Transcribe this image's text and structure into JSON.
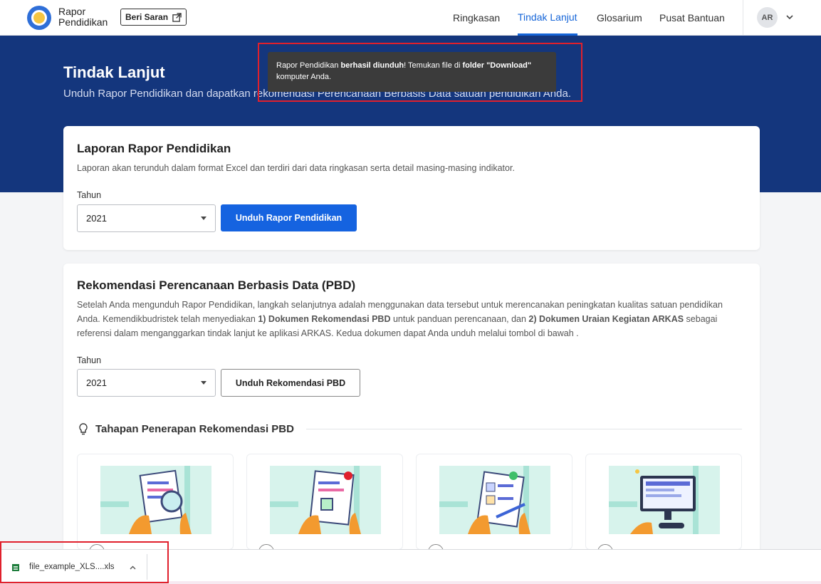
{
  "header": {
    "brand_line1": "Rapor",
    "brand_line2": "Pendidikan",
    "feedback_label": "Beri Saran",
    "nav": [
      {
        "label": "Ringkasan"
      },
      {
        "label": "Tindak Lanjut"
      },
      {
        "label": "Glosarium"
      },
      {
        "label": "Pusat Bantuan"
      }
    ],
    "avatar_initials": "AR"
  },
  "hero": {
    "title": "Tindak Lanjut",
    "subtitle": "Unduh Rapor Pendidikan dan dapatkan rekomendasi Perencanaan Berbasis Data satuan pendidikan Anda."
  },
  "toast": {
    "text1": "Rapor Pendidikan ",
    "bold1": "berhasil diunduh",
    "text2": "! Temukan file di ",
    "bold2": "folder \"Download\"",
    "text3": "komputer Anda."
  },
  "laporan": {
    "title": "Laporan Rapor Pendidikan",
    "desc": "Laporan akan terunduh dalam format Excel dan terdiri dari data ringkasan serta detail masing-masing indikator.",
    "year_label": "Tahun",
    "year_value": "2021",
    "button": "Unduh Rapor Pendidikan"
  },
  "pbd": {
    "title": "Rekomendasi Perencanaan Berbasis Data (PBD)",
    "desc1": "Setelah Anda mengunduh Rapor Pendidikan, langkah selanjutnya adalah menggunakan data tersebut untuk merencanakan peningkatan kualitas satuan pendidikan Anda. Kemendikbudristek telah menyediakan ",
    "desc_bold1": "1) Dokumen Rekomendasi PBD",
    "desc2": " untuk panduan perencanaan, dan ",
    "desc_bold2": "2) Dokumen Uraian Kegiatan ARKAS",
    "desc3": " sebagai referensi dalam menganggarkan tindak lanjut ke aplikasi ARKAS. Kedua dokumen dapat Anda unduh melalui tombol di bawah .",
    "year_label": "Tahun",
    "year_value": "2021",
    "button": "Unduh Rekomendasi PBD",
    "steps_heading": "Tahapan Penerapan Rekomendasi PBD"
  },
  "download_bar": {
    "filename": "file_example_XLS....xls"
  },
  "colors": {
    "primary": "#1563e0",
    "hero_bg": "#14367d",
    "highlight": "#e0202c"
  }
}
